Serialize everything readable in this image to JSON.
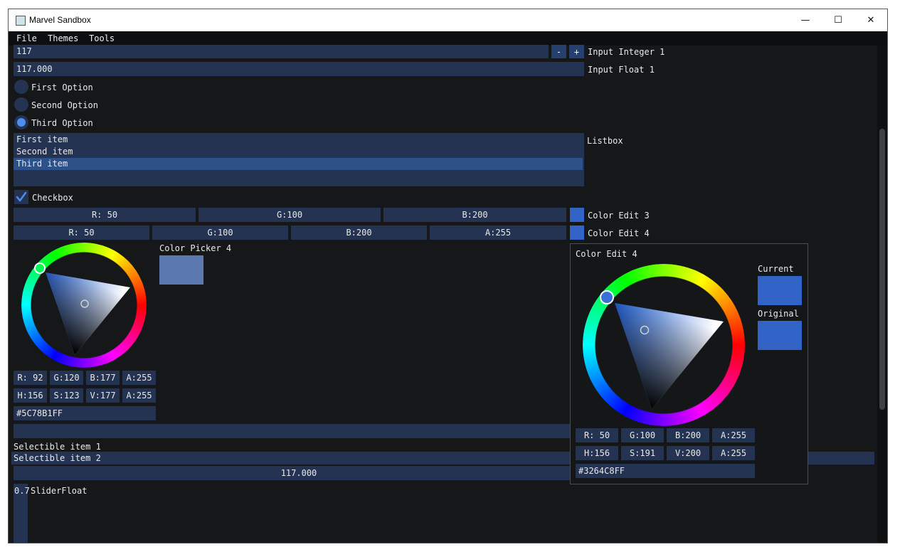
{
  "window": {
    "title": "Marvel Sandbox",
    "minimize": "—",
    "maximize": "☐",
    "close": "✕"
  },
  "menu": [
    "File",
    "Themes",
    "Tools"
  ],
  "input_int": {
    "value": "117",
    "minus": "-",
    "plus": "+",
    "label": "Input Integer 1"
  },
  "input_float": {
    "value": "117.000",
    "label": "Input Float 1"
  },
  "radios": [
    {
      "label": "First Option",
      "selected": false
    },
    {
      "label": "Second Option",
      "selected": false
    },
    {
      "label": "Third Option",
      "selected": true
    }
  ],
  "listbox": {
    "label": "Listbox",
    "items": [
      "First item",
      "Second item",
      "Third item"
    ],
    "selected_index": 2
  },
  "checkbox": {
    "label": "Checkbox",
    "checked": true
  },
  "color_edit_3": {
    "r": "R: 50",
    "g": "G:100",
    "b": "B:200",
    "label": "Color Edit 3",
    "color": "#3264c8"
  },
  "color_edit_4": {
    "r": "R: 50",
    "g": "G:100",
    "b": "B:200",
    "a": "A:255",
    "label": "Color Edit 4",
    "color": "#3264c8"
  },
  "color_picker": {
    "label": "Color Picker 4",
    "color": "#5c78b1",
    "rgba": [
      "R: 92",
      "G:120",
      "B:177",
      "A:255"
    ],
    "hsva": [
      "H:156",
      "S:123",
      "V:177",
      "A:255"
    ],
    "hex": "#5C78B1FF"
  },
  "popup": {
    "title": "Color Edit 4",
    "current_label": "Current",
    "original_label": "Original",
    "current_color": "#3264c8",
    "original_color": "#3264c8",
    "rgba": [
      "R: 50",
      "G:100",
      "B:200",
      "A:255"
    ],
    "hsva": [
      "H:156",
      "S:191",
      "V:200",
      "A:255"
    ],
    "hex": "#3264C8FF"
  },
  "selectables": [
    "Selectible item 1",
    "Selectible item 2"
  ],
  "drag_float": "117.000",
  "slider_float": {
    "value": "0.7",
    "label": "SliderFloat"
  },
  "colors": {
    "frame_bg": "#243352",
    "accent": "#4d8ff0",
    "window_bg": "#161719"
  }
}
